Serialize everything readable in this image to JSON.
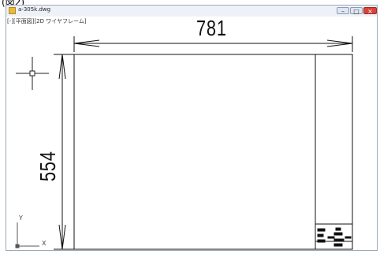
{
  "caption": "(図2)",
  "window": {
    "title": "a-305k.dwg",
    "viewport_label": "[-][平面図][2D ワイヤフレーム]",
    "buttons": {
      "minimize": "–",
      "maximize": "□",
      "close": "×"
    }
  },
  "drawing": {
    "width_dimension": "781",
    "height_dimension": "554",
    "ucs_x_label": "X",
    "ucs_y_label": "Y"
  },
  "colors": {
    "titlebar": "#eef2f8",
    "close_button": "#d8443a",
    "line": "#111111"
  }
}
